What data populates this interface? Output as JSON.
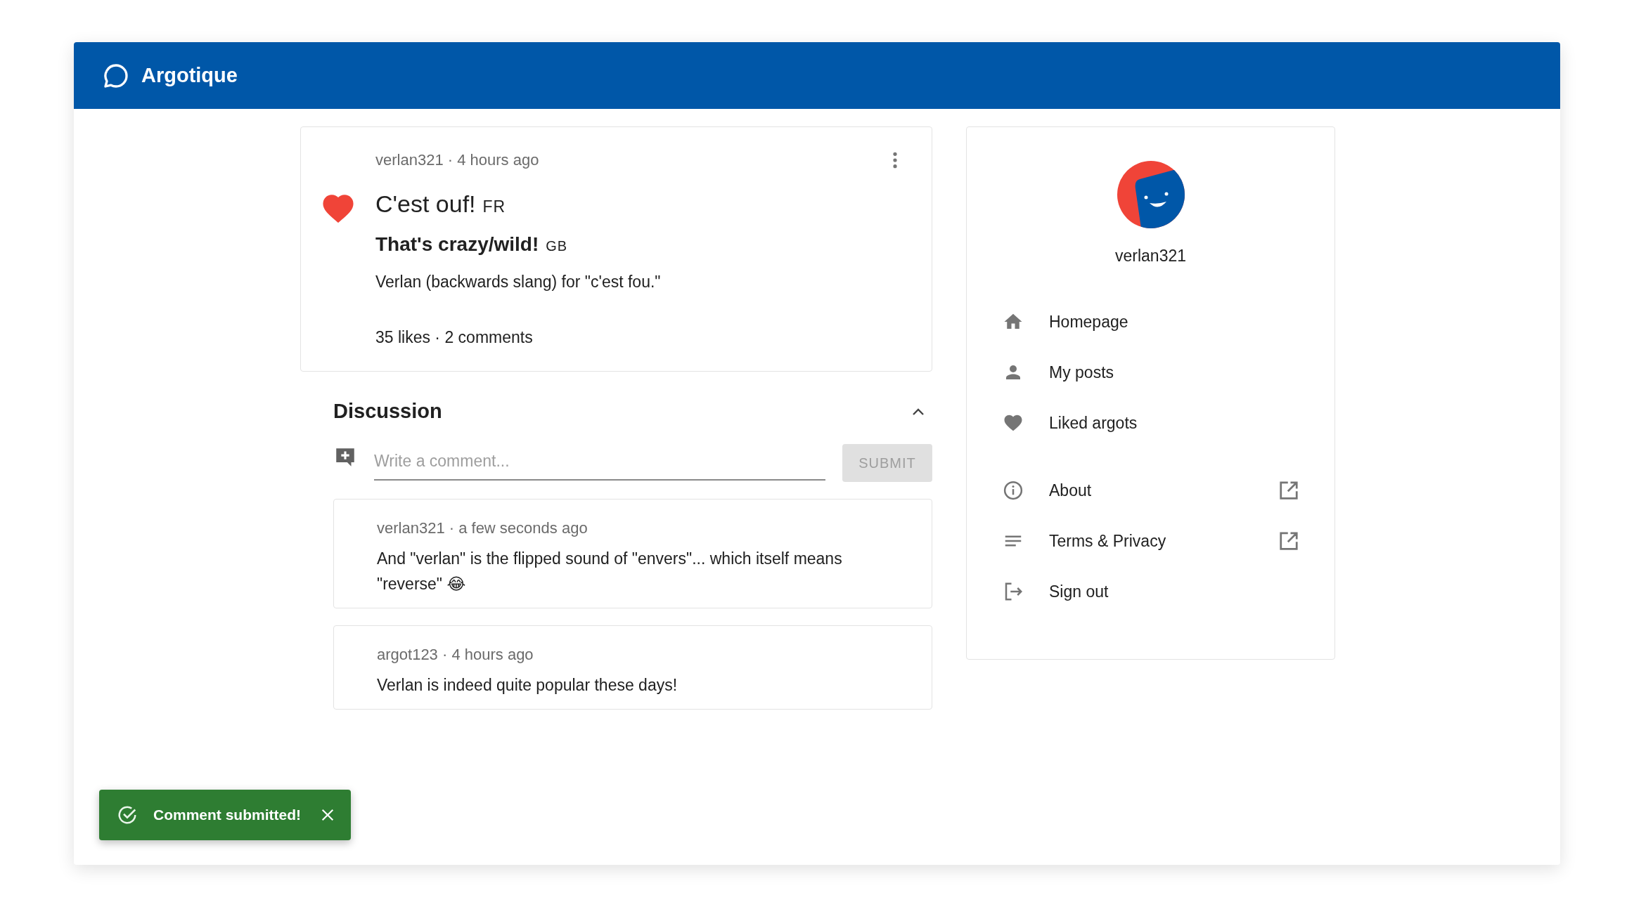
{
  "app": {
    "title": "Argotique"
  },
  "post": {
    "meta": "verlan321 · 4 hours ago",
    "liked": true,
    "title": "C'est ouf!",
    "title_lang": "FR",
    "translation": "That's crazy/wild!",
    "translation_lang": "GB",
    "description": "Verlan (backwards slang) for \"c'est fou.\"",
    "stats": "35 likes · 2 comments"
  },
  "discussion": {
    "title": "Discussion",
    "expanded": true,
    "comment_field": {
      "placeholder": "Write a comment..."
    },
    "submit": {
      "label": "SUBMIT",
      "disabled": true
    },
    "comments": [
      {
        "meta": "verlan321 · a few seconds ago",
        "text": "And \"verlan\" is the flipped sound of \"envers\"... which itself means \"reverse\" 😂"
      },
      {
        "meta": "argot123 · 4 hours ago",
        "text": "Verlan is indeed quite popular these days!"
      }
    ]
  },
  "profile": {
    "username": "verlan321",
    "nav_groups": [
      {
        "items": [
          {
            "label": "Homepage",
            "kind": "home",
            "external": false
          },
          {
            "label": "My posts",
            "kind": "person",
            "external": false
          },
          {
            "label": "Liked argots",
            "kind": "heart",
            "external": false
          }
        ]
      },
      {
        "items": [
          {
            "label": "About",
            "kind": "info",
            "external": true
          },
          {
            "label": "Terms & Privacy",
            "kind": "lines",
            "external": true
          },
          {
            "label": "Sign out",
            "kind": "exit",
            "external": false
          }
        ]
      }
    ]
  },
  "toast": {
    "message": "Comment submitted!"
  }
}
